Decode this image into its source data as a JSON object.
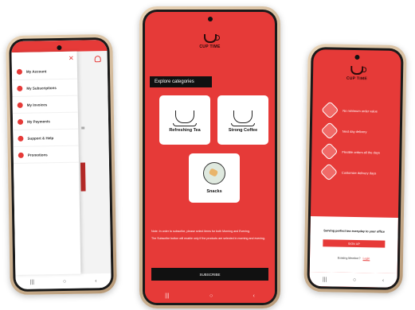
{
  "brand": {
    "logo_name": "CUP TIME",
    "logo_tagline": "",
    "primary_color": "#e63a38"
  },
  "left_phone": {
    "drawer_items": [
      {
        "label": "My Account",
        "icon": "user-icon"
      },
      {
        "label": "My Subscriptions",
        "icon": "subscription-icon"
      },
      {
        "label": "My Invoices",
        "icon": "invoice-icon"
      },
      {
        "label": "My Payments",
        "icon": "payment-icon"
      },
      {
        "label": "Support & Help",
        "icon": "support-icon"
      },
      {
        "label": "Promotions",
        "icon": "promotion-icon"
      }
    ]
  },
  "center_phone": {
    "explore_title": "Explore categories",
    "categories": [
      {
        "label": "Refreshing Tea",
        "icon": "tea-cup-icon"
      },
      {
        "label": "Strong Coffee",
        "icon": "coffee-cup-icon"
      },
      {
        "label": "Snacks",
        "icon": "snacks-icon"
      }
    ],
    "note_1": "Note: In order to subscribe, please select items for both Morning and Evening.",
    "note_2": "The Subscribe button will enable only if the products are selected in morning and evening.",
    "subscribe_label": "SUBSCRIBE"
  },
  "right_phone": {
    "features": [
      {
        "label": "No minimum order value",
        "icon": "minimum-order-icon"
      },
      {
        "label": "Next day delivery",
        "icon": "delivery-icon"
      },
      {
        "label": "Flexible orders all the days",
        "icon": "calendar-icon"
      },
      {
        "label": "Customize delivery days",
        "icon": "customize-icon"
      }
    ],
    "signup_prompt": "Serving perfect tea everyday to your office",
    "signup_label": "SIGN UP",
    "existing_prompt": "Existing Member?",
    "login_label": "Login"
  }
}
